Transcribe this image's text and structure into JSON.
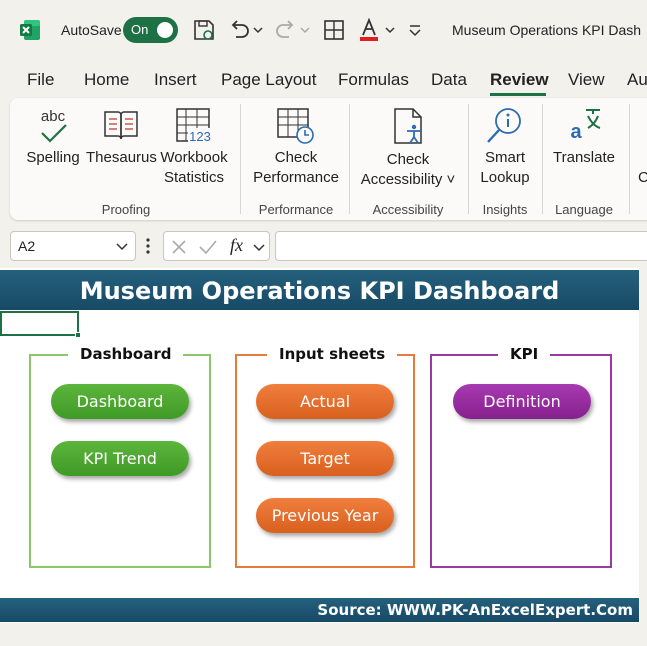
{
  "titlebar": {
    "autosave_label": "AutoSave",
    "autosave_state": "On",
    "window_title": "Museum Operations KPI Dash"
  },
  "tabs": [
    {
      "label": "File"
    },
    {
      "label": "Home"
    },
    {
      "label": "Insert"
    },
    {
      "label": "Page Layout"
    },
    {
      "label": "Formulas"
    },
    {
      "label": "Data"
    },
    {
      "label": "Review",
      "active": true
    },
    {
      "label": "View"
    },
    {
      "label": "Au"
    }
  ],
  "ribbon": {
    "groups": {
      "proofing": "Proofing",
      "performance": "Performance",
      "accessibility": "Accessibility",
      "insights": "Insights",
      "language": "Language"
    },
    "commands": {
      "spelling": "Spelling",
      "spelling_icon_text": "abc",
      "thesaurus": "Thesaurus",
      "workbook_stats_line1": "Workbook",
      "workbook_stats_line2": "Statistics",
      "workbook_stats_icon_text": "123",
      "check_perf_line1": "Check",
      "check_perf_line2": "Performance",
      "check_access_line1": "Check",
      "check_access_line2": "Accessibility ˅",
      "smart_lookup_line1": "Smart",
      "smart_lookup_line2": "Lookup",
      "translate": "Translate",
      "next_cut": "C"
    }
  },
  "formula_bar": {
    "name_box": "A2",
    "fx_label": "fx",
    "formula_value": ""
  },
  "sheet": {
    "title": "Museum Operations KPI Dashboard",
    "footer": "Source: WWW.PK-AnExcelExpert.Com",
    "groups": [
      {
        "title": "Dashboard",
        "color": "#8cc66a",
        "buttons": [
          "Dashboard",
          "KPI Trend"
        ]
      },
      {
        "title": "Input sheets",
        "color": "#e87a3a",
        "buttons": [
          "Actual",
          "Target",
          "Previous Year"
        ]
      },
      {
        "title": "KPI",
        "color": "#9b3aa4",
        "buttons": [
          "Definition"
        ]
      }
    ]
  },
  "colors": {
    "accent_green": "#1e7145",
    "header_blue": "#1b5573",
    "pill_green": "#4ea832",
    "pill_orange": "#e66d2c",
    "pill_purple": "#972c9f"
  }
}
